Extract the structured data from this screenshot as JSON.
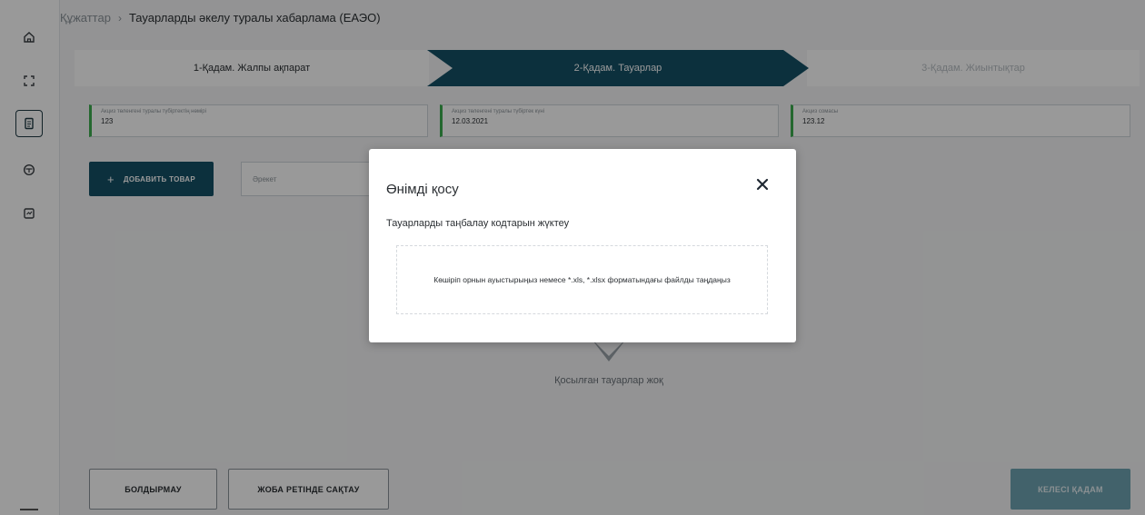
{
  "breadcrumb": {
    "link": "Құжаттар",
    "separator": "›",
    "current": "Тауарларды әкелу туралы хабарлама (ЕАЭО)"
  },
  "sidebar": {
    "items": [
      {
        "icon": "home-icon"
      },
      {
        "icon": "scan-frame-icon"
      },
      {
        "icon": "document-icon",
        "active": true
      },
      {
        "icon": "package-icon"
      },
      {
        "icon": "chart-box-icon"
      }
    ]
  },
  "stepper": {
    "steps": [
      {
        "label": "1-Қадам. Жалпы ақпарат",
        "state": "done"
      },
      {
        "label": "2-Қадам. Тауарлар",
        "state": "active"
      },
      {
        "label": "3-Қадам. Жиынтықтар",
        "state": "pending"
      }
    ]
  },
  "fields": [
    {
      "label": "Акциз төленгені туралы түбіртектің нөмірі",
      "value": "123"
    },
    {
      "label": "Акциз төленгені туралы түбіртек күні",
      "value": "12.03.2021"
    },
    {
      "label": "Акциз сомасы",
      "value": "123.12"
    }
  ],
  "toolbar": {
    "add_label": "ДОБАВИТЬ ТОВАР",
    "add_icon": "plus-icon",
    "action_placeholder": "Әрекет"
  },
  "empty_state": {
    "text": "Қосылған тауарлар жоқ"
  },
  "footer": {
    "cancel_label": "БОЛДЫРМАУ",
    "draft_label": "ЖОБА РЕТІНДЕ САҚТАУ",
    "next_label": "КЕЛЕСІ ҚАДАМ"
  },
  "modal": {
    "title": "Өнімді қосу",
    "subtitle": "Тауарларды таңбалау кодтарын жүктеу",
    "dropzone_text": "Көшіріп орнын ауыстырыңыз немесе *.xls, *.xlsx форматындағы файлды таңдаңыз",
    "close_icon": "close-icon"
  },
  "colors": {
    "primary": "#145067",
    "field_accent": "#3cae4f",
    "next_disabled": "#6fa3b3"
  }
}
